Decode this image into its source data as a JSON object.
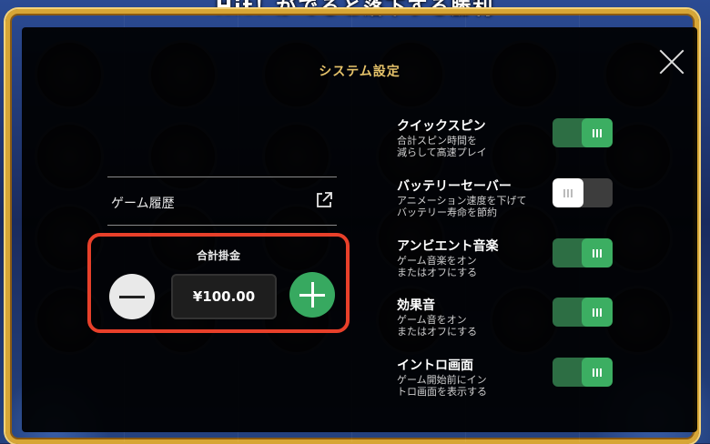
{
  "background": {
    "title": "Hit！がでると落下する勝利"
  },
  "dialog": {
    "title": "システム設定",
    "close_icon": "close-icon"
  },
  "history": {
    "label": "ゲーム履歴",
    "icon": "external-link-icon"
  },
  "bet": {
    "label": "合計掛金",
    "value": "¥100.00",
    "minus_icon": "minus-icon",
    "plus_icon": "plus-icon"
  },
  "settings": [
    {
      "title": "クイックスピン",
      "description": "合計スピン時間を\n減らして高速プレイ",
      "enabled": true
    },
    {
      "title": "バッテリーセーバー",
      "description": "アニメーション速度を下げて\nバッテリー寿命を節約",
      "enabled": false
    },
    {
      "title": "アンビエント音楽",
      "description": "ゲーム音楽をオン\nまたはオフにする",
      "enabled": true
    },
    {
      "title": "効果音",
      "description": "ゲーム音をオン\nまたはオフにする",
      "enabled": true
    },
    {
      "title": "イントロ画面",
      "description": "ゲーム開始前にイン\nトロ画面を表示する",
      "enabled": true
    }
  ],
  "colors": {
    "accent_gold": "#e6c36a",
    "toggle_on": "#3cae62",
    "highlight_border": "#e8402a"
  }
}
